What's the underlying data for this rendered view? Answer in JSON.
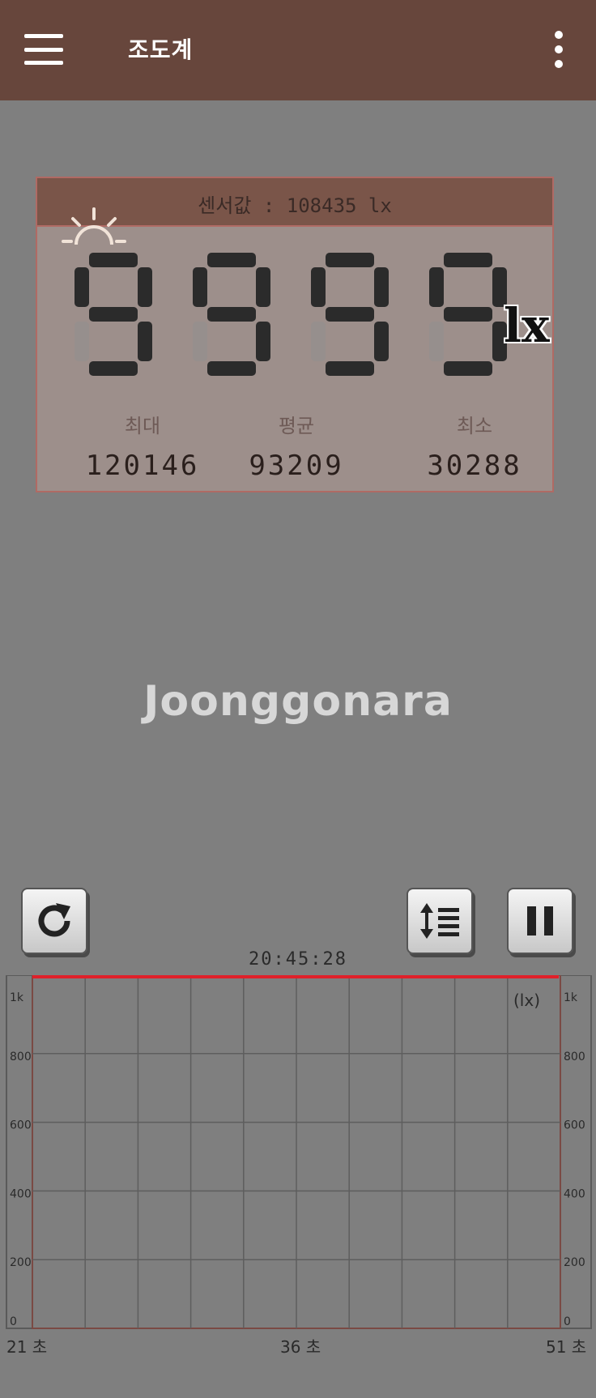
{
  "appbar": {
    "title": "조도계",
    "menu_icon": "hamburger-menu-icon",
    "more_icon": "more-vert-icon"
  },
  "meter": {
    "sensor_label": "센서값",
    "sensor_separator": ":",
    "sensor_value": "108435",
    "sensor_unit": "lx",
    "display_value": "9999",
    "display_unit": "lx",
    "stats": [
      {
        "label": "최대",
        "value": "120146"
      },
      {
        "label": "평균",
        "value": "93209"
      },
      {
        "label": "최소",
        "value": "30288"
      }
    ]
  },
  "watermark": {
    "text": "Joonggonara"
  },
  "controls": {
    "reset_icon": "refresh-icon",
    "scale_icon": "vertical-scale-icon",
    "pause_icon": "pause-icon"
  },
  "graph": {
    "timestamp": "20:45:28",
    "unit_label": "(lx)",
    "y_ticks": [
      "1k",
      "800",
      "600",
      "400",
      "200",
      "0"
    ],
    "x_labels": [
      "21 초",
      "36 초",
      "51 초"
    ],
    "line_color": "#e0202a",
    "level_value": 1000
  }
}
